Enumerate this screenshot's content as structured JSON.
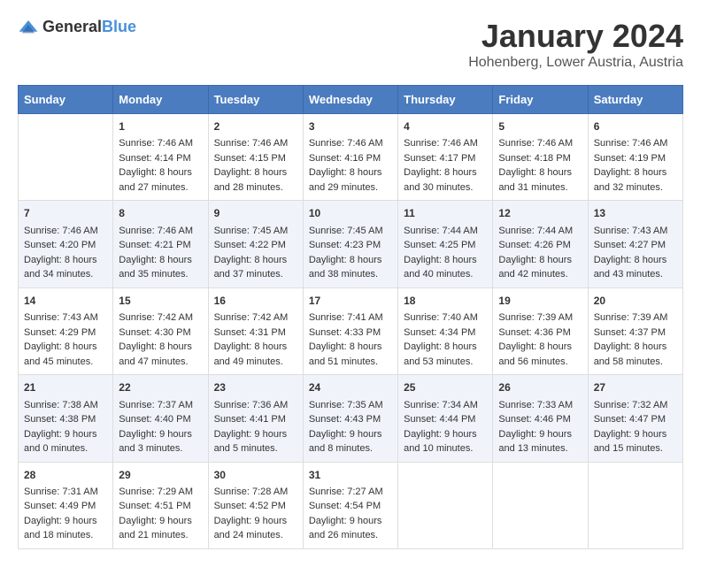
{
  "logo": {
    "general": "General",
    "blue": "Blue"
  },
  "title": "January 2024",
  "subtitle": "Hohenberg, Lower Austria, Austria",
  "days_header": [
    "Sunday",
    "Monday",
    "Tuesday",
    "Wednesday",
    "Thursday",
    "Friday",
    "Saturday"
  ],
  "weeks": [
    {
      "cells": [
        {
          "day": "",
          "content": ""
        },
        {
          "day": "1",
          "content": "Sunrise: 7:46 AM\nSunset: 4:14 PM\nDaylight: 8 hours\nand 27 minutes."
        },
        {
          "day": "2",
          "content": "Sunrise: 7:46 AM\nSunset: 4:15 PM\nDaylight: 8 hours\nand 28 minutes."
        },
        {
          "day": "3",
          "content": "Sunrise: 7:46 AM\nSunset: 4:16 PM\nDaylight: 8 hours\nand 29 minutes."
        },
        {
          "day": "4",
          "content": "Sunrise: 7:46 AM\nSunset: 4:17 PM\nDaylight: 8 hours\nand 30 minutes."
        },
        {
          "day": "5",
          "content": "Sunrise: 7:46 AM\nSunset: 4:18 PM\nDaylight: 8 hours\nand 31 minutes."
        },
        {
          "day": "6",
          "content": "Sunrise: 7:46 AM\nSunset: 4:19 PM\nDaylight: 8 hours\nand 32 minutes."
        }
      ]
    },
    {
      "cells": [
        {
          "day": "7",
          "content": "Sunrise: 7:46 AM\nSunset: 4:20 PM\nDaylight: 8 hours\nand 34 minutes."
        },
        {
          "day": "8",
          "content": "Sunrise: 7:46 AM\nSunset: 4:21 PM\nDaylight: 8 hours\nand 35 minutes."
        },
        {
          "day": "9",
          "content": "Sunrise: 7:45 AM\nSunset: 4:22 PM\nDaylight: 8 hours\nand 37 minutes."
        },
        {
          "day": "10",
          "content": "Sunrise: 7:45 AM\nSunset: 4:23 PM\nDaylight: 8 hours\nand 38 minutes."
        },
        {
          "day": "11",
          "content": "Sunrise: 7:44 AM\nSunset: 4:25 PM\nDaylight: 8 hours\nand 40 minutes."
        },
        {
          "day": "12",
          "content": "Sunrise: 7:44 AM\nSunset: 4:26 PM\nDaylight: 8 hours\nand 42 minutes."
        },
        {
          "day": "13",
          "content": "Sunrise: 7:43 AM\nSunset: 4:27 PM\nDaylight: 8 hours\nand 43 minutes."
        }
      ]
    },
    {
      "cells": [
        {
          "day": "14",
          "content": "Sunrise: 7:43 AM\nSunset: 4:29 PM\nDaylight: 8 hours\nand 45 minutes."
        },
        {
          "day": "15",
          "content": "Sunrise: 7:42 AM\nSunset: 4:30 PM\nDaylight: 8 hours\nand 47 minutes."
        },
        {
          "day": "16",
          "content": "Sunrise: 7:42 AM\nSunset: 4:31 PM\nDaylight: 8 hours\nand 49 minutes."
        },
        {
          "day": "17",
          "content": "Sunrise: 7:41 AM\nSunset: 4:33 PM\nDaylight: 8 hours\nand 51 minutes."
        },
        {
          "day": "18",
          "content": "Sunrise: 7:40 AM\nSunset: 4:34 PM\nDaylight: 8 hours\nand 53 minutes."
        },
        {
          "day": "19",
          "content": "Sunrise: 7:39 AM\nSunset: 4:36 PM\nDaylight: 8 hours\nand 56 minutes."
        },
        {
          "day": "20",
          "content": "Sunrise: 7:39 AM\nSunset: 4:37 PM\nDaylight: 8 hours\nand 58 minutes."
        }
      ]
    },
    {
      "cells": [
        {
          "day": "21",
          "content": "Sunrise: 7:38 AM\nSunset: 4:38 PM\nDaylight: 9 hours\nand 0 minutes."
        },
        {
          "day": "22",
          "content": "Sunrise: 7:37 AM\nSunset: 4:40 PM\nDaylight: 9 hours\nand 3 minutes."
        },
        {
          "day": "23",
          "content": "Sunrise: 7:36 AM\nSunset: 4:41 PM\nDaylight: 9 hours\nand 5 minutes."
        },
        {
          "day": "24",
          "content": "Sunrise: 7:35 AM\nSunset: 4:43 PM\nDaylight: 9 hours\nand 8 minutes."
        },
        {
          "day": "25",
          "content": "Sunrise: 7:34 AM\nSunset: 4:44 PM\nDaylight: 9 hours\nand 10 minutes."
        },
        {
          "day": "26",
          "content": "Sunrise: 7:33 AM\nSunset: 4:46 PM\nDaylight: 9 hours\nand 13 minutes."
        },
        {
          "day": "27",
          "content": "Sunrise: 7:32 AM\nSunset: 4:47 PM\nDaylight: 9 hours\nand 15 minutes."
        }
      ]
    },
    {
      "cells": [
        {
          "day": "28",
          "content": "Sunrise: 7:31 AM\nSunset: 4:49 PM\nDaylight: 9 hours\nand 18 minutes."
        },
        {
          "day": "29",
          "content": "Sunrise: 7:29 AM\nSunset: 4:51 PM\nDaylight: 9 hours\nand 21 minutes."
        },
        {
          "day": "30",
          "content": "Sunrise: 7:28 AM\nSunset: 4:52 PM\nDaylight: 9 hours\nand 24 minutes."
        },
        {
          "day": "31",
          "content": "Sunrise: 7:27 AM\nSunset: 4:54 PM\nDaylight: 9 hours\nand 26 minutes."
        },
        {
          "day": "",
          "content": ""
        },
        {
          "day": "",
          "content": ""
        },
        {
          "day": "",
          "content": ""
        }
      ]
    }
  ]
}
